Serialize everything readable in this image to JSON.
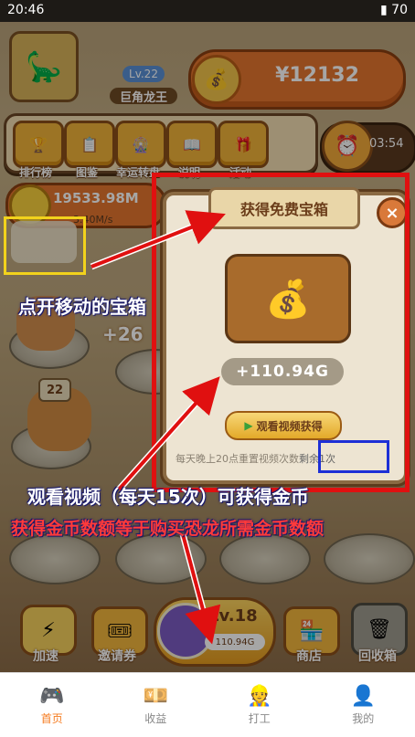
{
  "status_bar": {
    "time": "20:46",
    "battery": "70"
  },
  "player": {
    "level": "Lv.22",
    "name": "巨角龙王",
    "money": "¥12132"
  },
  "menu": {
    "rank": "排行榜",
    "catalog": "图鉴",
    "wheel": "幸运转盘",
    "help": "说明",
    "event": "活动",
    "timer": "03:54"
  },
  "coins": {
    "total": "19533.98M",
    "rate": "3.40M/s"
  },
  "field": {
    "plus_label": "+26",
    "dino_level": "22"
  },
  "dialog": {
    "title": "获得免费宝箱",
    "close": "×",
    "amount": "+110.94G",
    "watch_button": "观看视频获得",
    "note": "每天晚上20点重置视频次数",
    "remaining": "剩余1次"
  },
  "annotations": {
    "tap_chest": "点开移动的宝箱",
    "watch_video": "观看视频（每天15次）可获得金币",
    "equal_cost": "获得金币数额等于购买恐龙所需金币数额"
  },
  "action_bar": {
    "speed": "加速",
    "coupon": "邀请券",
    "buy_level": "Lv.18",
    "buy_price": "110.94G",
    "shop": "商店",
    "recycle": "回收箱"
  },
  "nav": [
    {
      "label": "首页",
      "icon": "gamepad-icon",
      "active": true
    },
    {
      "label": "收益",
      "icon": "money-bag-icon",
      "active": false
    },
    {
      "label": "打工",
      "icon": "worker-icon",
      "active": false
    },
    {
      "label": "我的",
      "icon": "user-icon",
      "active": false
    }
  ],
  "colors": {
    "accent": "#f57b1f",
    "highlight_red": "#e01010",
    "highlight_blue": "#1d2fd6",
    "highlight_yellow": "#f2d21c"
  }
}
